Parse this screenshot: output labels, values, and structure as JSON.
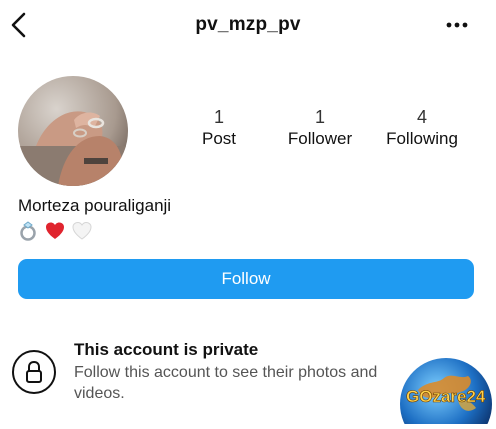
{
  "header": {
    "username": "pv_mzp_pv"
  },
  "stats": [
    {
      "value": "1",
      "label": "Post"
    },
    {
      "value": "1",
      "label": "Follower"
    },
    {
      "value": "4",
      "label": "Following"
    }
  ],
  "profile": {
    "display_name": "Morteza pouraliganji",
    "bio_emojis": [
      "ring",
      "red-heart",
      "white-heart"
    ]
  },
  "follow_button": {
    "label": "Follow",
    "color": "#1f9bf1"
  },
  "private_notice": {
    "title": "This account is private",
    "description": "Follow this account to see their photos and videos."
  },
  "watermark": {
    "text": "GOzare24"
  }
}
